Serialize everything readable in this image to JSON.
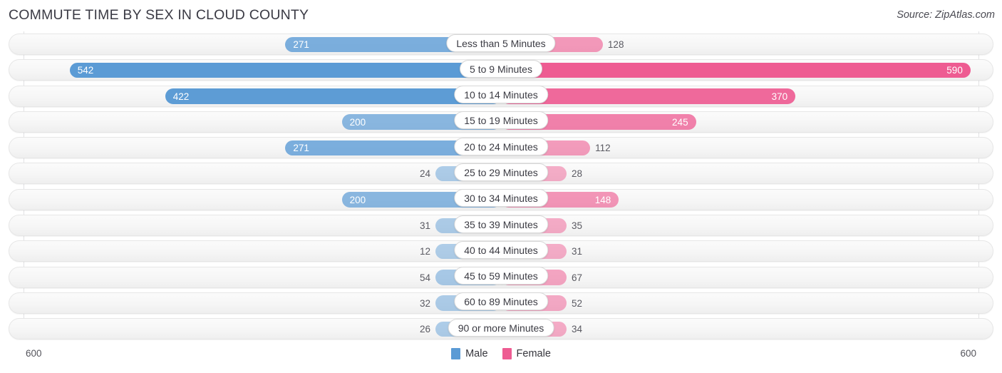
{
  "header": {
    "title": "COMMUTE TIME BY SEX IN CLOUD COUNTY",
    "source": "Source: ZipAtlas.com"
  },
  "legend": {
    "items": [
      {
        "label": "Male",
        "color": "#5b9bd5"
      },
      {
        "label": "Female",
        "color": "#ee5c92"
      }
    ]
  },
  "axis": {
    "left_label": "600",
    "right_label": "600"
  },
  "chart_data": {
    "type": "bar",
    "title": "COMMUTE TIME BY SEX IN CLOUD COUNTY",
    "subtitle": "",
    "orientation": "horizontal-diverging",
    "xlabel": "",
    "ylabel": "",
    "xlim": [
      -600,
      600
    ],
    "axis_max": 600,
    "grid": true,
    "legend_position": "bottom-center",
    "categories": [
      "Less than 5 Minutes",
      "5 to 9 Minutes",
      "10 to 14 Minutes",
      "15 to 19 Minutes",
      "20 to 24 Minutes",
      "25 to 29 Minutes",
      "30 to 34 Minutes",
      "35 to 39 Minutes",
      "40 to 44 Minutes",
      "45 to 59 Minutes",
      "60 to 89 Minutes",
      "90 or more Minutes"
    ],
    "series": [
      {
        "name": "Male",
        "color": "#5b9bd5",
        "direction": "left",
        "values": [
          271,
          542,
          422,
          200,
          271,
          24,
          200,
          31,
          12,
          54,
          32,
          26
        ]
      },
      {
        "name": "Female",
        "color": "#ee5c92",
        "direction": "right",
        "values": [
          128,
          590,
          370,
          245,
          112,
          28,
          148,
          35,
          31,
          67,
          52,
          34
        ]
      }
    ]
  },
  "rows": [
    {
      "label": "Less than 5 Minutes",
      "male": "271",
      "female": "128"
    },
    {
      "label": "5 to 9 Minutes",
      "male": "542",
      "female": "590"
    },
    {
      "label": "10 to 14 Minutes",
      "male": "422",
      "female": "370"
    },
    {
      "label": "15 to 19 Minutes",
      "male": "200",
      "female": "245"
    },
    {
      "label": "20 to 24 Minutes",
      "male": "271",
      "female": "112"
    },
    {
      "label": "25 to 29 Minutes",
      "male": "24",
      "female": "28"
    },
    {
      "label": "30 to 34 Minutes",
      "male": "200",
      "female": "148"
    },
    {
      "label": "35 to 39 Minutes",
      "male": "31",
      "female": "35"
    },
    {
      "label": "40 to 44 Minutes",
      "male": "12",
      "female": "31"
    },
    {
      "label": "45 to 59 Minutes",
      "male": "54",
      "female": "67"
    },
    {
      "label": "60 to 89 Minutes",
      "male": "32",
      "female": "52"
    },
    {
      "label": "90 or more Minutes",
      "male": "26",
      "female": "34"
    }
  ]
}
